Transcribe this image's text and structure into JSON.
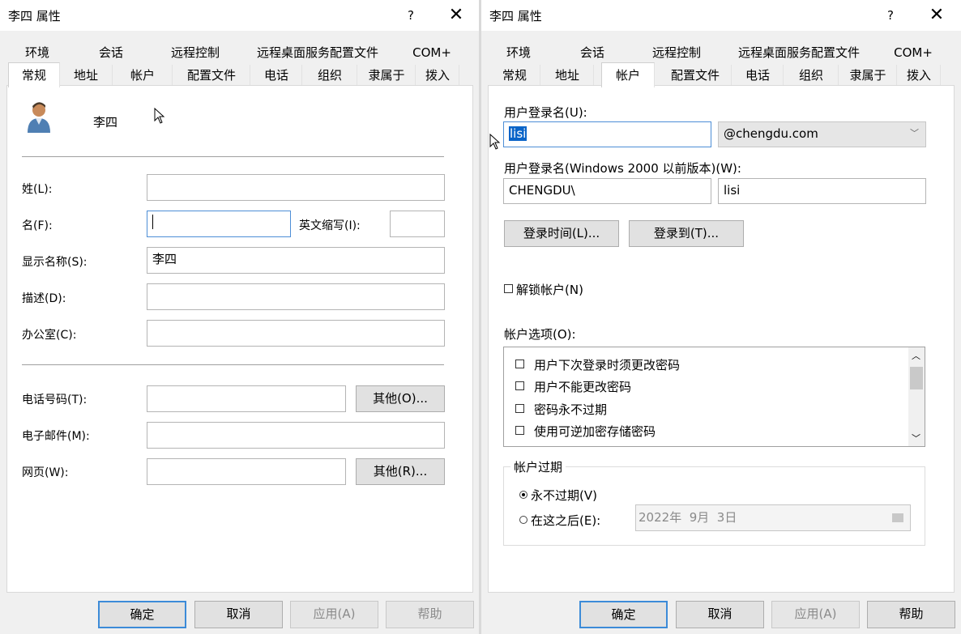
{
  "left": {
    "title": "李四 属性",
    "help": "?",
    "close": "✕",
    "tabs_row1": [
      "环境",
      "会话",
      "远程控制",
      "远程桌面服务配置文件",
      "COM+"
    ],
    "tabs_row2": [
      "常规",
      "地址",
      "帐户",
      "配置文件",
      "电话",
      "组织",
      "隶属于",
      "拨入"
    ],
    "active_tab": "常规",
    "display_name_header": "李四",
    "fields": {
      "last_name_label": "姓(L):",
      "last_name_value": "",
      "first_name_label": "名(F):",
      "first_name_value": "",
      "initials_label": "英文缩写(I):",
      "initials_value": "",
      "display_name_label": "显示名称(S):",
      "display_name_value": "李四",
      "description_label": "描述(D):",
      "description_value": "",
      "office_label": "办公室(C):",
      "office_value": "",
      "phone_label": "电话号码(T):",
      "phone_value": "",
      "phone_other": "其他(O)...",
      "email_label": "电子邮件(M):",
      "email_value": "",
      "web_label": "网页(W):",
      "web_value": "",
      "web_other": "其他(R)..."
    },
    "buttons": {
      "ok": "确定",
      "cancel": "取消",
      "apply": "应用(A)",
      "help": "帮助"
    }
  },
  "right": {
    "title": "李四 属性",
    "help": "?",
    "close": "✕",
    "tabs_row1": [
      "环境",
      "会话",
      "远程控制",
      "远程桌面服务配置文件",
      "COM+"
    ],
    "tabs_row2": [
      "常规",
      "地址",
      "帐户",
      "配置文件",
      "电话",
      "组织",
      "隶属于",
      "拨入"
    ],
    "active_tab": "帐户",
    "logon_name_label": "用户登录名(U):",
    "logon_name_value": "lisi",
    "domain_suffix": "@chengdu.com",
    "pre2000_label": "用户登录名(Windows 2000 以前版本)(W):",
    "pre2000_domain": "CHENGDU\\",
    "pre2000_name": "lisi",
    "logon_hours_button": "登录时间(L)...",
    "logon_to_button": "登录到(T)...",
    "unlock_label": "解锁帐户(N)",
    "account_options_label": "帐户选项(O):",
    "account_options": [
      "用户下次登录时须更改密码",
      "用户不能更改密码",
      "密码永不过期",
      "使用可逆加密存储密码"
    ],
    "expires_group": "帐户过期",
    "never_expires": "永不过期(V)",
    "end_of": "在这之后(E):",
    "expire_date": "2022年  9月  3日",
    "buttons": {
      "ok": "确定",
      "cancel": "取消",
      "apply": "应用(A)",
      "help": "帮助"
    }
  }
}
